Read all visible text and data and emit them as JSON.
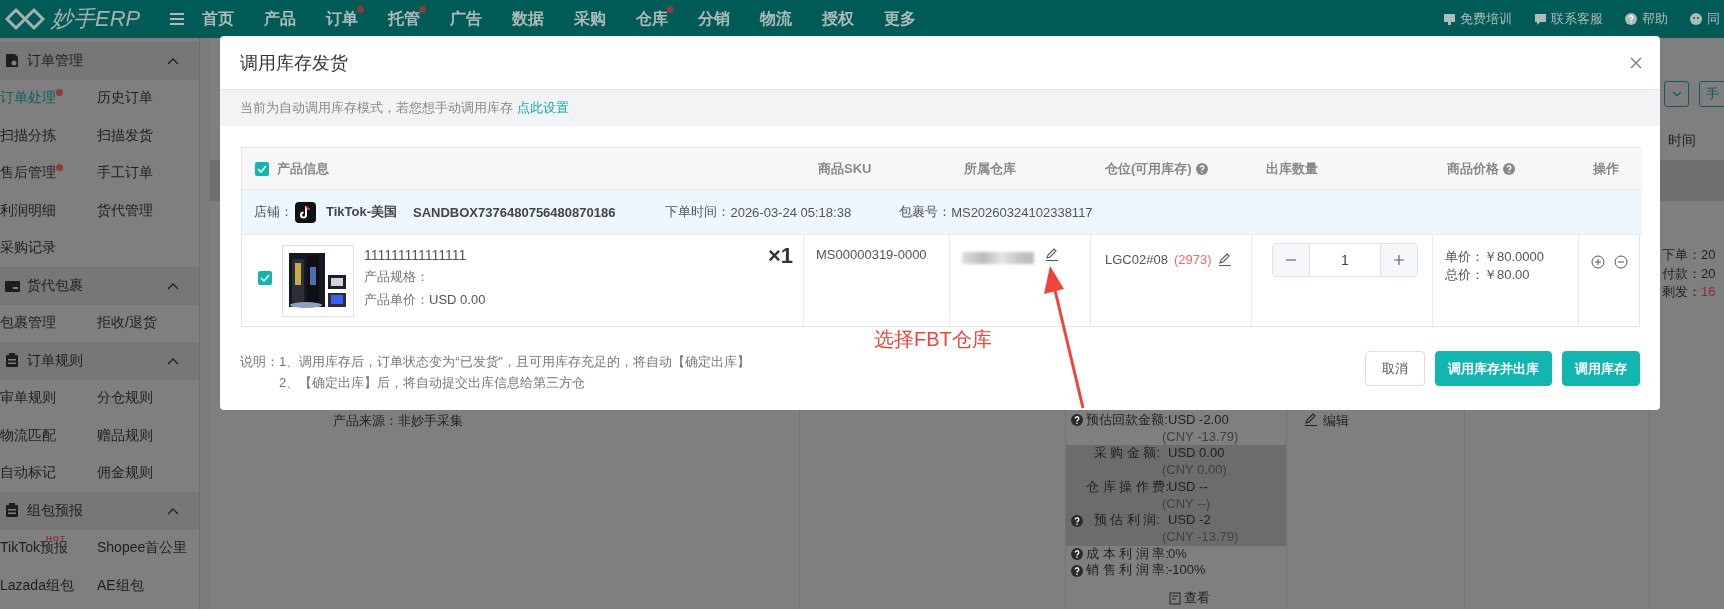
{
  "topbar": {
    "logo": "妙手ERP",
    "nav": [
      {
        "label": "首页",
        "dot": false
      },
      {
        "label": "产品",
        "dot": false
      },
      {
        "label": "订单",
        "dot": true
      },
      {
        "label": "托管",
        "dot": true
      },
      {
        "label": "广告",
        "dot": false
      },
      {
        "label": "数据",
        "dot": false
      },
      {
        "label": "采购",
        "dot": false
      },
      {
        "label": "仓库",
        "dot": true
      },
      {
        "label": "分销",
        "dot": false
      },
      {
        "label": "物流",
        "dot": false
      },
      {
        "label": "授权",
        "dot": false
      },
      {
        "label": "更多",
        "dot": false
      }
    ],
    "links": [
      "免费培训",
      "联系客服",
      "帮助",
      "同"
    ]
  },
  "sidebar": {
    "groups": [
      {
        "title": "订单管理",
        "expanded": true,
        "items": [
          {
            "label": "订单处理",
            "selected": true,
            "dot": true
          },
          {
            "label": "历史订单",
            "selected": false,
            "dot": false
          },
          {
            "label": "扫描分拣",
            "selected": false,
            "dot": false
          },
          {
            "label": "扫描发货",
            "selected": false,
            "dot": false
          },
          {
            "label": "售后管理",
            "selected": false,
            "dot": true
          },
          {
            "label": "手工订单",
            "selected": false,
            "dot": false
          },
          {
            "label": "利润明细",
            "selected": false,
            "dot": false
          },
          {
            "label": "货代管理",
            "selected": false,
            "dot": false
          },
          {
            "label": "采购记录",
            "selected": false,
            "dot": false
          }
        ]
      },
      {
        "title": "货代包裹",
        "expanded": true,
        "items": [
          {
            "label": "包裹管理",
            "selected": false,
            "dot": false
          },
          {
            "label": "拒收/退货",
            "selected": false,
            "dot": false
          }
        ]
      },
      {
        "title": "订单规则",
        "expanded": true,
        "items": [
          {
            "label": "审单规则",
            "selected": false,
            "dot": false
          },
          {
            "label": "分仓规则",
            "selected": false,
            "dot": false
          },
          {
            "label": "物流匹配",
            "selected": false,
            "dot": false
          },
          {
            "label": "赠品规则",
            "selected": false,
            "dot": false
          },
          {
            "label": "自动标记",
            "selected": false,
            "dot": false
          },
          {
            "label": "佣金规则",
            "selected": false,
            "dot": false
          }
        ]
      },
      {
        "title": "组包预报",
        "expanded": true,
        "items": [
          {
            "label": "TikTok预报",
            "selected": false,
            "dot": false,
            "badge": "HOT"
          },
          {
            "label": "Shopee首公里",
            "selected": false,
            "dot": false
          },
          {
            "label": "Lazada组包",
            "selected": false,
            "dot": false
          },
          {
            "label": "AE组包",
            "selected": false,
            "dot": false
          }
        ]
      }
    ]
  },
  "background": {
    "toolbar_button": "手",
    "time_column": "时间",
    "product_source": "产品来源：非妙手采集",
    "profit": [
      {
        "label": "预估回款金额:",
        "help": true,
        "value": "USD -2.00",
        "sub": "(CNY -13.79)",
        "shaded": false
      },
      {
        "label": "采 购 金 额:",
        "help": false,
        "value": "USD 0.00",
        "sub": "(CNY 0.00)",
        "shaded": true
      },
      {
        "label": "仓 库 操 作 费:",
        "help": false,
        "value": "USD --",
        "sub": "(CNY --)",
        "shaded": true
      },
      {
        "label": "预 估 利 润:",
        "help": true,
        "value": "USD -2",
        "sub": "(CNY -13.79)",
        "shaded": true
      },
      {
        "label": "成 本 利 润 率:",
        "help": true,
        "value": "0%",
        "shaded": false
      },
      {
        "label": "销 售 利 润 率:",
        "help": true,
        "value": "-100%",
        "shaded": false
      }
    ],
    "view": "查看",
    "edit": "编辑",
    "times": [
      {
        "label": "下单：",
        "value": "20",
        "alert": false
      },
      {
        "label": "付款：",
        "value": "20",
        "alert": false
      },
      {
        "label": "剩发：",
        "value": "16",
        "alert": true
      }
    ]
  },
  "dialog": {
    "title": "调用库存发货",
    "notice": {
      "text": "当前为自动调用库存模式，若您想手动调用库存",
      "link": "点此设置"
    },
    "table": {
      "all_checked": true,
      "columns": [
        {
          "label": "产品信息",
          "help": false
        },
        {
          "label": "商品SKU",
          "help": false
        },
        {
          "label": "所属仓库",
          "help": false
        },
        {
          "label": "仓位(可用库存)",
          "help": true
        },
        {
          "label": "出库数量",
          "help": false
        },
        {
          "label": "商品价格",
          "help": true
        },
        {
          "label": "操作",
          "help": false
        }
      ],
      "store": {
        "label": "店铺：",
        "name": "TikTok-美国",
        "order_id": "SANDBOX7376480756480870186",
        "time_label": "下单时间：",
        "time": "2026-03-24 05:18:38",
        "package_label": "包裹号：",
        "package": "MS20260324102338117"
      },
      "rows": [
        {
          "checked": true,
          "title": "111111111111111",
          "spec_label": "产品规格：",
          "price_label": "产品单价：",
          "price": "USD 0.00",
          "multiplier": "×1",
          "sku": "MS00000319-0000",
          "bin": "LGC02#08",
          "stock": "(2973)",
          "quantity": "1",
          "unit_price_label": "单价：",
          "unit_price": "￥80.0000",
          "total_label": "总价：",
          "total": "￥80.00"
        }
      ]
    },
    "notes": {
      "label": "说明：",
      "lines": [
        "1、调用库存后，订单状态变为“已发货”，且可用库存充足的，将自动【确定出库】",
        "2、【确定出库】后，将自动提交出库信息给第三方仓"
      ]
    },
    "buttons": [
      {
        "label": "取消",
        "kind": "default"
      },
      {
        "label": "调用库存并出库",
        "kind": "primary"
      },
      {
        "label": "调用库存",
        "kind": "primary"
      }
    ]
  },
  "annotation": {
    "text": "选择FBT仓库"
  }
}
